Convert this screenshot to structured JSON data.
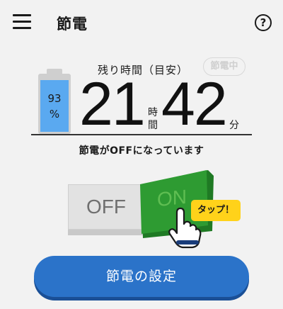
{
  "header": {
    "title": "節電",
    "menu_icon": "hamburger-menu-icon",
    "help_icon": "help-circle-icon",
    "help_glyph": "?"
  },
  "summary": {
    "remaining_label": "残り時間（目安）",
    "saving_badge": "節電中",
    "battery_percent_value": "93",
    "battery_percent_unit": "%",
    "battery_level": 0.93,
    "hours": "21",
    "hours_unit_1": "時",
    "hours_unit_2": "間",
    "minutes": "42",
    "minutes_unit": "分"
  },
  "status_text": "節電がOFFになっています",
  "toggle": {
    "off_label": "OFF",
    "on_label": "ON",
    "tap_hint": "タップ！"
  },
  "settings_button_label": "節電の設定",
  "colors": {
    "accent_blue": "#2b73c9",
    "battery_fill": "#5aa9f0",
    "switch_green": "#2e9b32",
    "hint_yellow": "#ffd21a"
  }
}
